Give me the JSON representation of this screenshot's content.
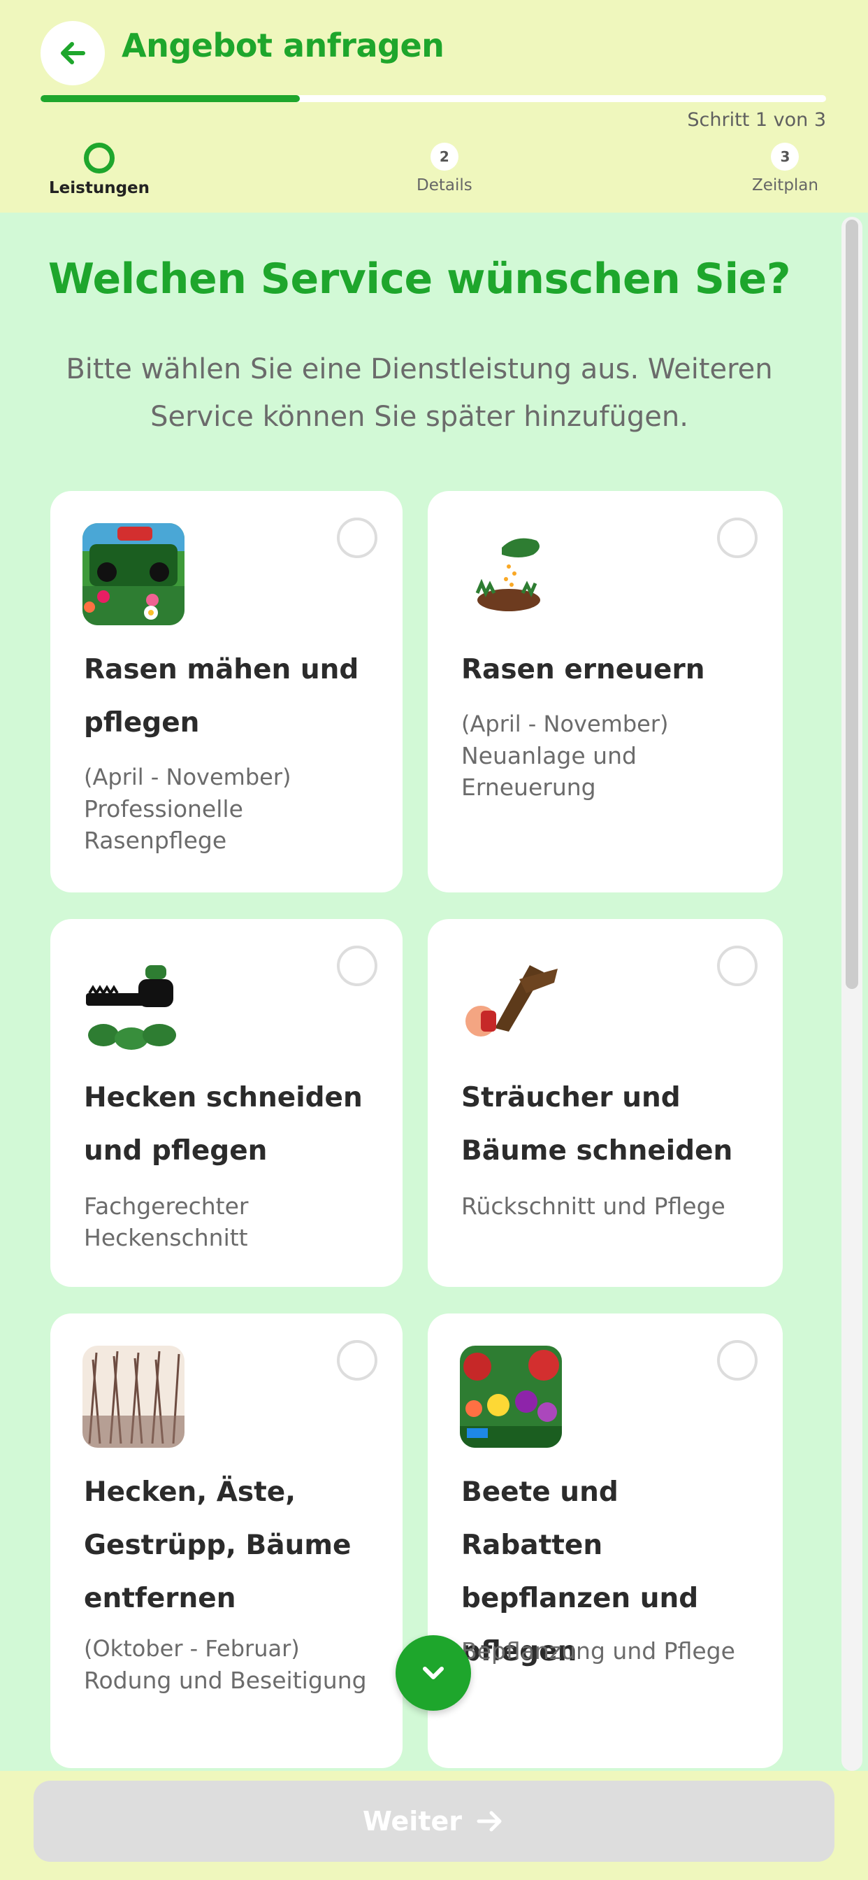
{
  "header": {
    "title": "Angebot anfragen",
    "progress": 0.33,
    "step_count": "Schritt 1 von 3",
    "steps": [
      {
        "number": "",
        "label": "Leistungen"
      },
      {
        "number": "2",
        "label": "Details"
      },
      {
        "number": "3",
        "label": "Zeitplan"
      }
    ]
  },
  "main": {
    "heading": "Welchen Service wünschen Sie?",
    "subtitle": "Bitte wählen Sie eine Dienstleistung aus. Weiteren Service können Sie später hinzufügen.",
    "services": [
      {
        "title": "Rasen mähen und pflegen",
        "season": "(April - November)",
        "description": "Professionelle Rasenpflege",
        "icon": "lawn-mower-icon"
      },
      {
        "title": "Rasen erneuern",
        "season": "(April - November)",
        "description": "Neuanlage und Erneuerung",
        "icon": "seeding-hand-icon"
      },
      {
        "title": "Hecken schneiden und pflegen",
        "season": "",
        "description": "Fachgerechter Heckenschnitt",
        "icon": "hedge-trimmer-icon"
      },
      {
        "title": "Sträucher und Bäume schneiden",
        "season": "",
        "description": "Rückschnitt und Pflege",
        "icon": "pruning-shears-icon"
      },
      {
        "title": "Hecken, Äste, Gestrüpp, Bäume entfernen",
        "season": "(Oktober - Februar)",
        "description": "Rodung und Beseitigung",
        "icon": "brushwood-icon"
      },
      {
        "title": "Beete und Rabatten bepflanzen und pflegen",
        "season": "",
        "description": "Bepflanzung und Pflege",
        "icon": "flower-bed-icon"
      }
    ]
  },
  "footer": {
    "next_label": "Weiter"
  },
  "colors": {
    "accent": "#1ea62c",
    "header_bg": "#eff7bd",
    "page_bg": "#d2f9d6",
    "disabled_button": "#dddddd"
  }
}
